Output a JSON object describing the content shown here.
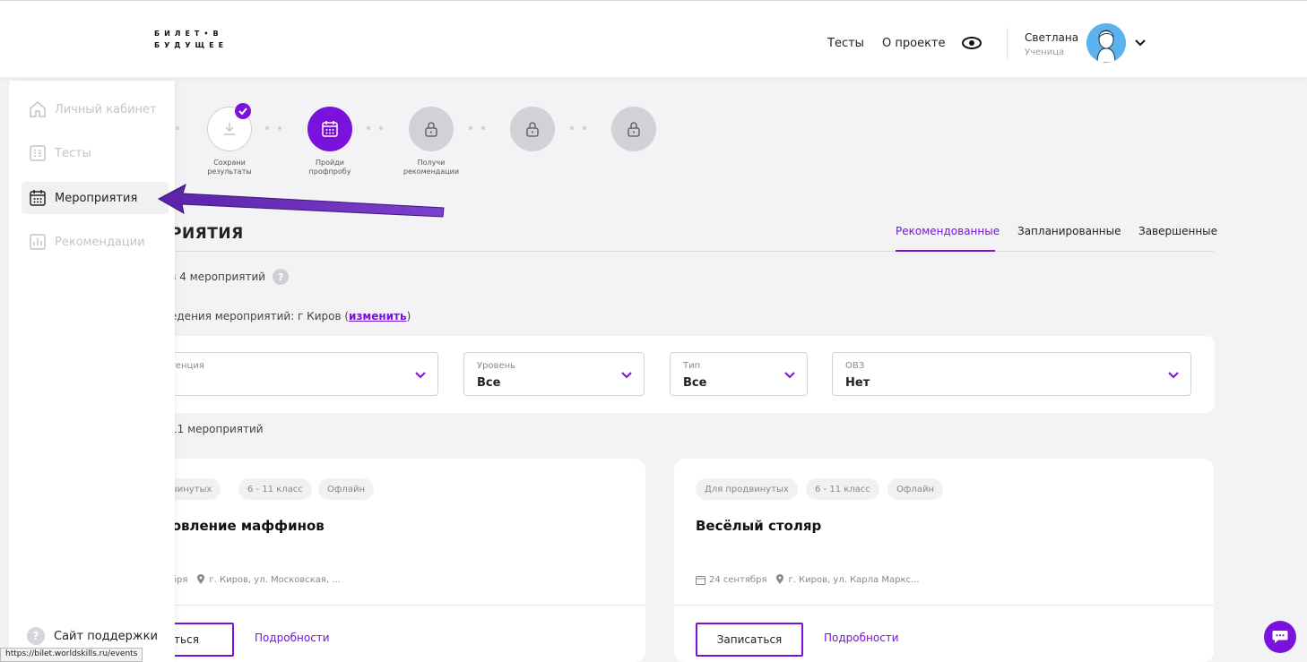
{
  "header": {
    "logo_line1": "БИЛЕТ•В",
    "logo_line2": "БУДУЩЕЕ",
    "nav": [
      "Тесты",
      "О проекте"
    ],
    "user_name": "Светлана",
    "user_role": "Ученица"
  },
  "sidebar": {
    "items": [
      {
        "label": "Личный кабинет",
        "icon": "home-icon"
      },
      {
        "label": "Тесты",
        "icon": "test-icon"
      },
      {
        "label": "Мероприятия",
        "icon": "calendar-icon"
      },
      {
        "label": "Рекомендации",
        "icon": "chart-icon"
      }
    ],
    "active_index": 2,
    "support_label": "Сайт поддержки"
  },
  "status_url": "https://bilet.worldskills.ru/events",
  "steps": {
    "labels": [
      {
        "line1": "Сохрани",
        "line2": "результаты"
      },
      {
        "line1": "Пройди",
        "line2": "профпробу"
      },
      {
        "line1": "Получи",
        "line2": "рекомендации"
      }
    ]
  },
  "main": {
    "title": "РИЯТИЯ",
    "tabs": [
      "Рекомендованные",
      "Запланированные",
      "Завершенные"
    ],
    "active_tab": 0,
    "count_line": "з 4 мероприятий",
    "location_prefix": "едения мероприятий: г Киров (",
    "location_link": "изменить",
    "location_suffix": ")",
    "results_line": "11 мероприятий"
  },
  "filters": [
    {
      "label": "тенция",
      "value": ""
    },
    {
      "label": "Уровень",
      "value": "Все"
    },
    {
      "label": "Тип",
      "value": "Все"
    },
    {
      "label": "ОВЗ",
      "value": "Нет"
    }
  ],
  "cards": [
    {
      "badges": [
        "двинутых",
        "6 - 11 класс",
        "Офлайн"
      ],
      "title": "товление маффинов",
      "date": "тября",
      "address": "г. Киров, ул. Московская, ...",
      "signup": "саться",
      "details": "Подробности"
    },
    {
      "badges": [
        "Для продвинутых",
        "6 - 11 класс",
        "Офлайн"
      ],
      "title": "Весёлый столяр",
      "date": "24 сентября",
      "address": "г. Киров, ул. Карла Маркс...",
      "signup": "Записаться",
      "details": "Подробности"
    }
  ],
  "colors": {
    "accent": "#7a12dc",
    "annotation_arrow": "#6a2bb8"
  }
}
